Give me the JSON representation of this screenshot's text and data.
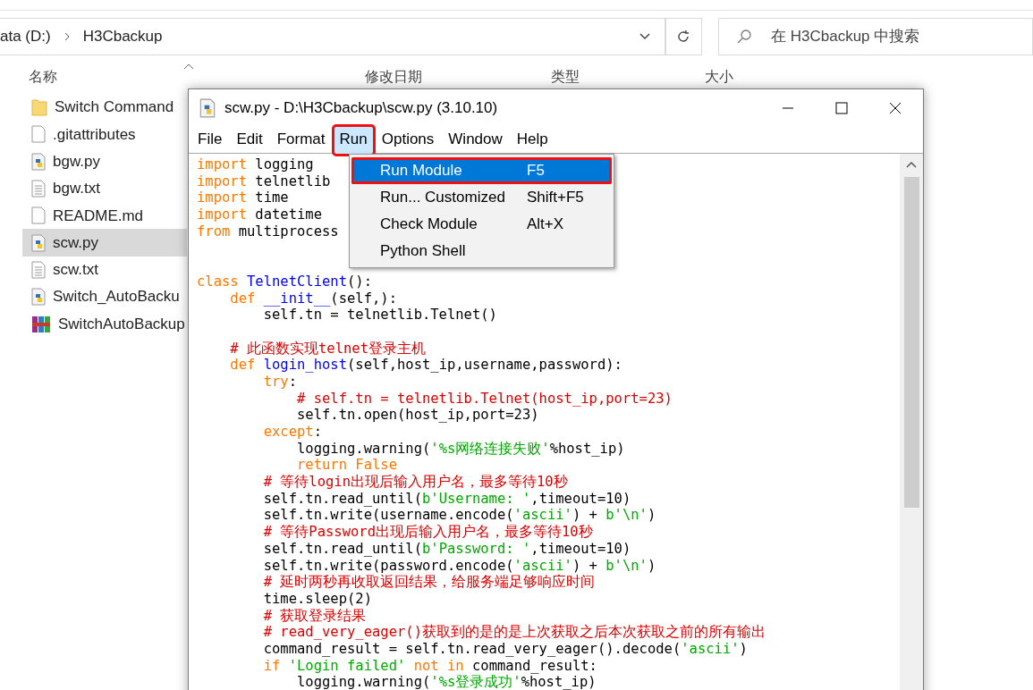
{
  "explorer": {
    "breadcrumb": [
      {
        "label": "ata (D:)"
      },
      {
        "label": "H3Cbackup"
      }
    ],
    "search": {
      "placeholder": "在 H3Cbackup 中搜索"
    },
    "columns": [
      "名称",
      "修改日期",
      "类型",
      "大小"
    ],
    "files": [
      {
        "name": "Switch Command",
        "kind": "folder",
        "selected": false
      },
      {
        "name": ".gitattributes",
        "kind": "file",
        "selected": false
      },
      {
        "name": "bgw.py",
        "kind": "python",
        "selected": false
      },
      {
        "name": "bgw.txt",
        "kind": "text",
        "selected": false
      },
      {
        "name": "README.md",
        "kind": "file",
        "selected": false
      },
      {
        "name": "scw.py",
        "kind": "python",
        "selected": true
      },
      {
        "name": "scw.txt",
        "kind": "text",
        "selected": false
      },
      {
        "name": "Switch_AutoBacku",
        "kind": "python",
        "selected": false
      },
      {
        "name": "SwitchAutoBackup",
        "kind": "archive",
        "selected": false
      }
    ]
  },
  "editor": {
    "title": "scw.py - D:\\H3Cbackup\\scw.py (3.10.10)",
    "menu": [
      {
        "label": "File",
        "selected": false,
        "annotated": false
      },
      {
        "label": "Edit",
        "selected": false,
        "annotated": false
      },
      {
        "label": "Format",
        "selected": false,
        "annotated": false
      },
      {
        "label": "Run",
        "selected": true,
        "annotated": true
      },
      {
        "label": "Options",
        "selected": false,
        "annotated": false
      },
      {
        "label": "Window",
        "selected": false,
        "annotated": false
      },
      {
        "label": "Help",
        "selected": false,
        "annotated": false
      }
    ],
    "dropdown": [
      {
        "label": "Run Module",
        "shortcut": "F5",
        "selected": true,
        "annotated": true
      },
      {
        "label": "Run... Customized",
        "shortcut": "Shift+F5",
        "selected": false,
        "annotated": false
      },
      {
        "label": "Check Module",
        "shortcut": "Alt+X",
        "selected": false,
        "annotated": false
      },
      {
        "label": "Python Shell",
        "selected": false,
        "annotated": false
      }
    ],
    "lines": [
      {
        "kind": "code",
        "tokens": [
          {
            "kind": "keyword",
            "text": "import"
          },
          {
            "kind": "plain",
            "text": " logging"
          }
        ]
      },
      {
        "kind": "code",
        "tokens": [
          {
            "kind": "keyword",
            "text": "import"
          },
          {
            "kind": "plain",
            "text": " telnetlib"
          }
        ]
      },
      {
        "kind": "code",
        "tokens": [
          {
            "kind": "keyword",
            "text": "import"
          },
          {
            "kind": "plain",
            "text": " time"
          }
        ]
      },
      {
        "kind": "code",
        "tokens": [
          {
            "kind": "keyword",
            "text": "import"
          },
          {
            "kind": "plain",
            "text": " datetime"
          }
        ]
      },
      {
        "kind": "code",
        "tokens": [
          {
            "kind": "keyword",
            "text": "from"
          },
          {
            "kind": "plain",
            "text": " multiprocess"
          }
        ]
      },
      {
        "kind": "blank"
      },
      {
        "kind": "blank"
      },
      {
        "kind": "code",
        "tokens": [
          {
            "kind": "keyword",
            "text": "class"
          },
          {
            "kind": "name",
            "text": " TelnetClient"
          },
          {
            "kind": "plain",
            "text": "():"
          }
        ]
      },
      {
        "kind": "code",
        "tokens": [
          {
            "kind": "keyword",
            "text": "    def"
          },
          {
            "kind": "name",
            "text": " __init__"
          },
          {
            "kind": "plain",
            "text": "(self,):"
          }
        ]
      },
      {
        "kind": "code",
        "tokens": [
          {
            "kind": "plain",
            "text": "        self.tn = telnetlib.Telnet()"
          }
        ]
      },
      {
        "kind": "blank"
      },
      {
        "kind": "code",
        "tokens": [
          {
            "kind": "comment",
            "text": "    # 此函数实现telnet登录主机"
          }
        ]
      },
      {
        "kind": "code",
        "tokens": [
          {
            "kind": "keyword",
            "text": "    def"
          },
          {
            "kind": "name",
            "text": " login_host"
          },
          {
            "kind": "plain",
            "text": "(self,host_ip,username,password):"
          }
        ]
      },
      {
        "kind": "code",
        "tokens": [
          {
            "kind": "keyword",
            "text": "        try"
          },
          {
            "kind": "plain",
            "text": ":"
          }
        ]
      },
      {
        "kind": "code",
        "tokens": [
          {
            "kind": "comment",
            "text": "            # self.tn = telnetlib.Telnet(host_ip,port=23)"
          }
        ]
      },
      {
        "kind": "code",
        "tokens": [
          {
            "kind": "plain",
            "text": "            self.tn.open(host_ip,port=23)"
          }
        ]
      },
      {
        "kind": "code",
        "tokens": [
          {
            "kind": "keyword",
            "text": "        except"
          },
          {
            "kind": "plain",
            "text": ":"
          }
        ]
      },
      {
        "kind": "code",
        "tokens": [
          {
            "kind": "plain",
            "text": "            logging.warning("
          },
          {
            "kind": "string",
            "text": "'%s网络连接失败'"
          },
          {
            "kind": "plain",
            "text": "%host_ip)"
          }
        ]
      },
      {
        "kind": "code",
        "tokens": [
          {
            "kind": "keyword",
            "text": "            return False"
          }
        ]
      },
      {
        "kind": "code",
        "tokens": [
          {
            "kind": "comment",
            "text": "        # 等待login出现后输入用户名，最多等待10秒"
          }
        ]
      },
      {
        "kind": "code",
        "tokens": [
          {
            "kind": "plain",
            "text": "        self.tn.read_until("
          },
          {
            "kind": "string",
            "text": "b'Username: '"
          },
          {
            "kind": "plain",
            "text": ",timeout=10)"
          }
        ]
      },
      {
        "kind": "code",
        "tokens": [
          {
            "kind": "plain",
            "text": "        self.tn.write(username.encode("
          },
          {
            "kind": "string",
            "text": "'ascii'"
          },
          {
            "kind": "plain",
            "text": ") + "
          },
          {
            "kind": "string",
            "text": "b'\\n'"
          },
          {
            "kind": "plain",
            "text": ")"
          }
        ]
      },
      {
        "kind": "code",
        "tokens": [
          {
            "kind": "comment",
            "text": "        # 等待Password出现后输入用户名，最多等待10秒"
          }
        ]
      },
      {
        "kind": "code",
        "tokens": [
          {
            "kind": "plain",
            "text": "        self.tn.read_until("
          },
          {
            "kind": "string",
            "text": "b'Password: '"
          },
          {
            "kind": "plain",
            "text": ",timeout=10)"
          }
        ]
      },
      {
        "kind": "code",
        "tokens": [
          {
            "kind": "plain",
            "text": "        self.tn.write(password.encode("
          },
          {
            "kind": "string",
            "text": "'ascii'"
          },
          {
            "kind": "plain",
            "text": ") + "
          },
          {
            "kind": "string",
            "text": "b'\\n'"
          },
          {
            "kind": "plain",
            "text": ")"
          }
        ]
      },
      {
        "kind": "code",
        "tokens": [
          {
            "kind": "comment",
            "text": "        # 延时两秒再收取返回结果，给服务端足够响应时间"
          }
        ]
      },
      {
        "kind": "code",
        "tokens": [
          {
            "kind": "plain",
            "text": "        time.sleep(2)"
          }
        ]
      },
      {
        "kind": "code",
        "tokens": [
          {
            "kind": "comment",
            "text": "        # 获取登录结果"
          }
        ]
      },
      {
        "kind": "code",
        "tokens": [
          {
            "kind": "comment",
            "text": "        # read_very_eager()获取到的是的是上次获取之后本次获取之前的所有输出"
          }
        ]
      },
      {
        "kind": "code",
        "tokens": [
          {
            "kind": "plain",
            "text": "        command_result = self.tn.read_very_eager().decode("
          },
          {
            "kind": "string",
            "text": "'ascii'"
          },
          {
            "kind": "plain",
            "text": ")"
          }
        ]
      },
      {
        "kind": "code",
        "tokens": [
          {
            "kind": "keyword",
            "text": "        if"
          },
          {
            "kind": "string",
            "text": " 'Login failed'"
          },
          {
            "kind": "keyword",
            "text": " not in"
          },
          {
            "kind": "plain",
            "text": " command_result:"
          }
        ]
      },
      {
        "kind": "code",
        "tokens": [
          {
            "kind": "plain",
            "text": "            logging.warning("
          },
          {
            "kind": "string",
            "text": "'%s登录成功'"
          },
          {
            "kind": "plain",
            "text": "%host_ip)"
          }
        ]
      }
    ]
  }
}
